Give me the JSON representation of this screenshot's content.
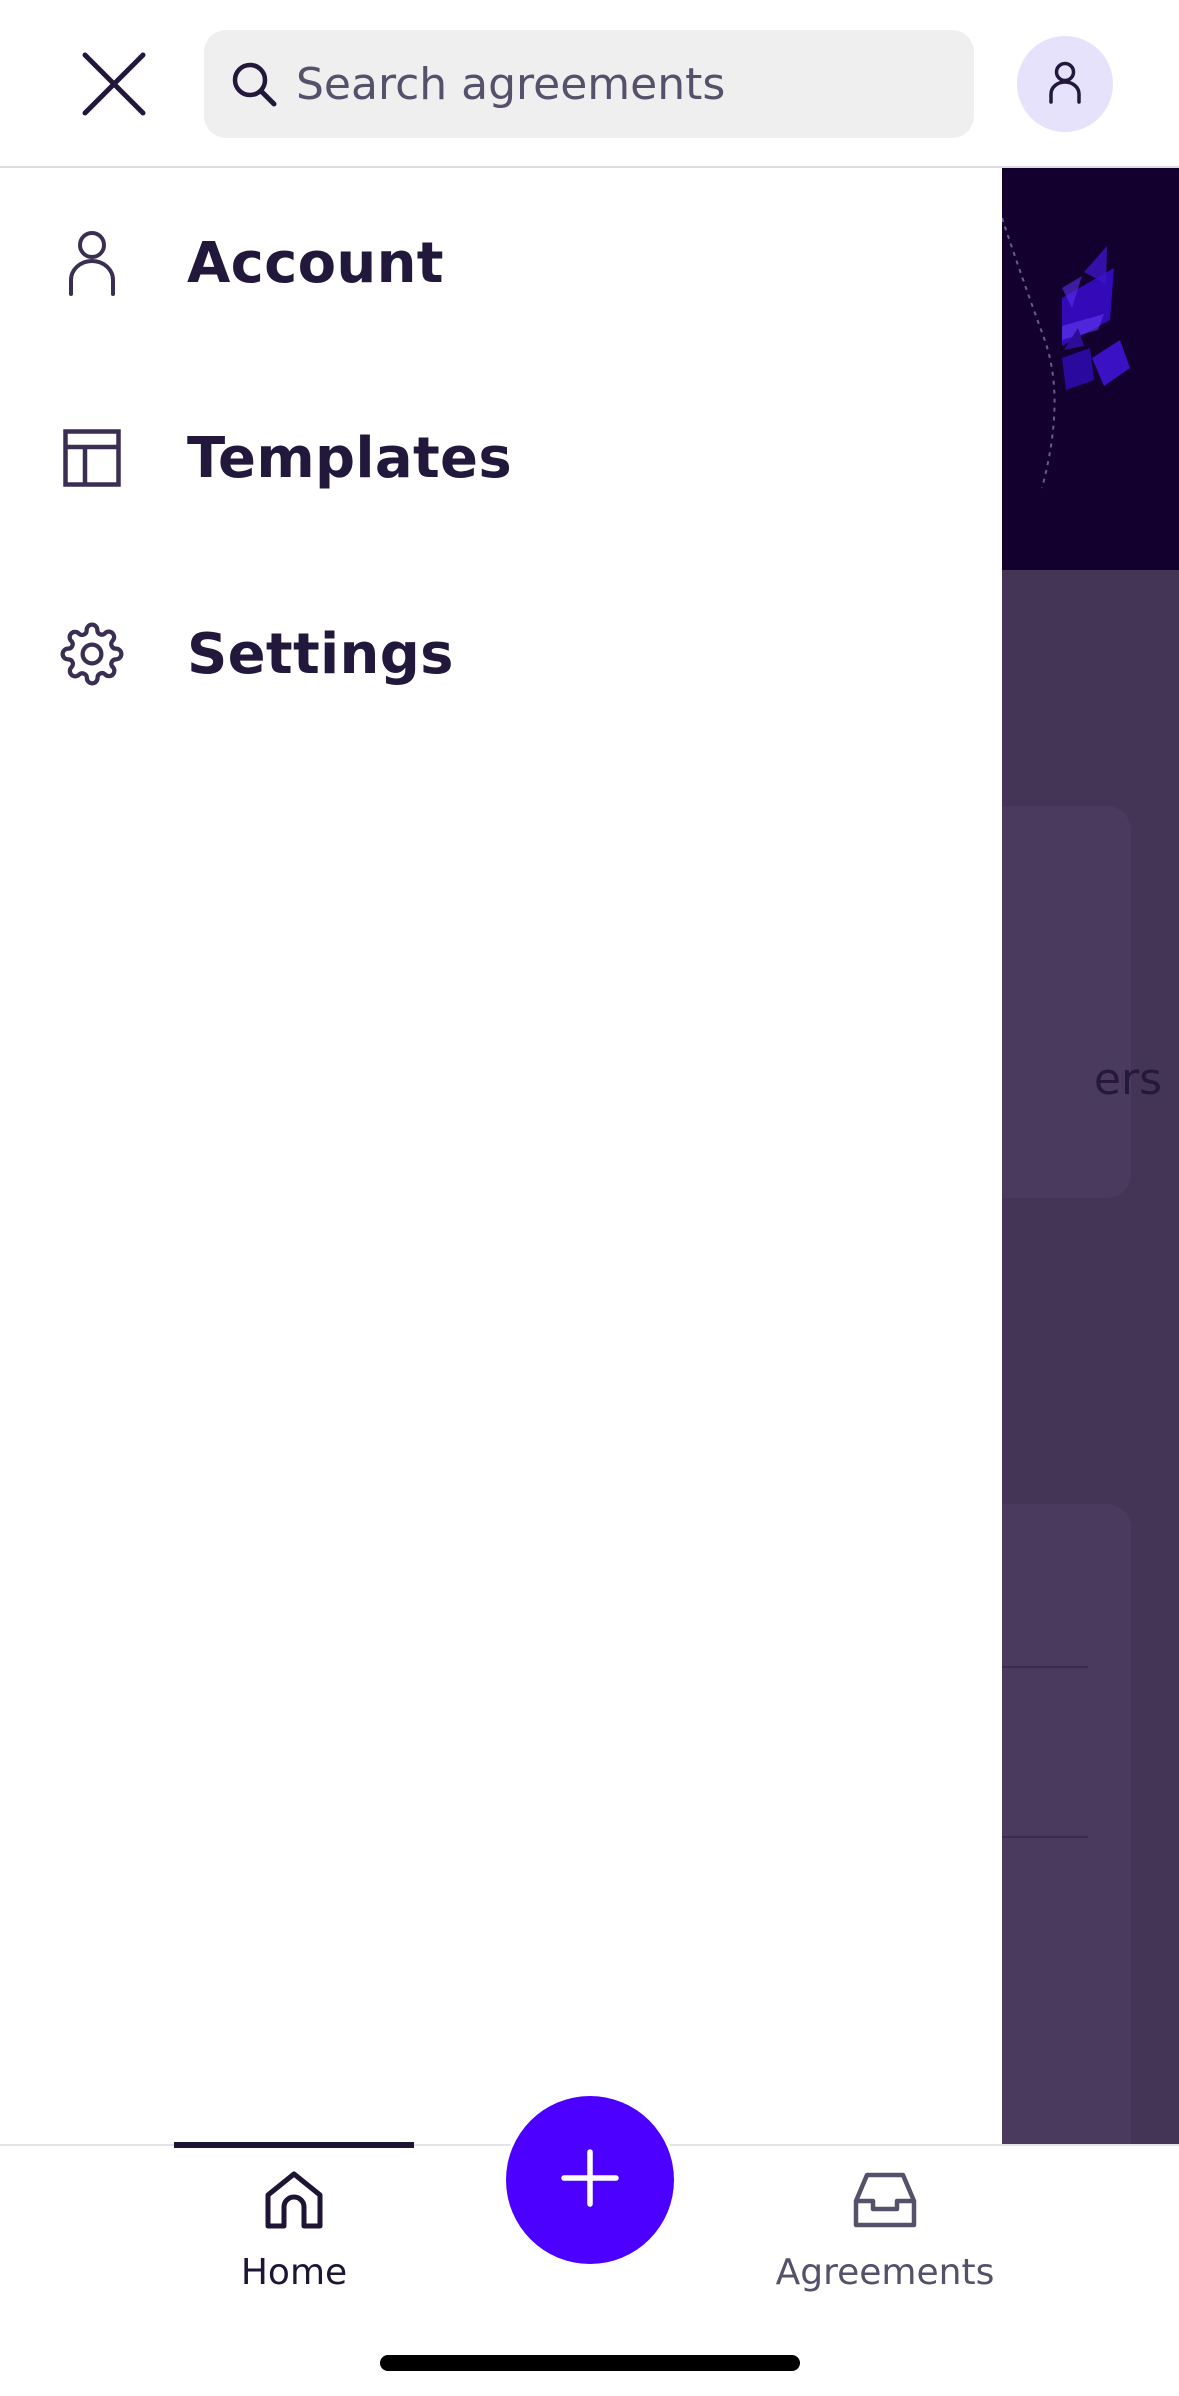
{
  "header": {
    "close_icon": "close-icon",
    "search": {
      "placeholder": "Search agreements",
      "value": "",
      "icon": "search-icon"
    },
    "avatar_icon": "person-icon"
  },
  "drawer": {
    "items": [
      {
        "label": "Account",
        "icon": "person-icon"
      },
      {
        "label": "Templates",
        "icon": "template-layout-icon"
      },
      {
        "label": "Settings",
        "icon": "gear-icon"
      }
    ]
  },
  "background": {
    "card_text_fragment": "ers"
  },
  "bottom_nav": {
    "tabs": [
      {
        "label": "Home",
        "icon": "home-icon",
        "active": true
      },
      {
        "label": "Agreements",
        "icon": "inbox-icon",
        "active": false
      }
    ],
    "fab_icon": "plus-icon"
  },
  "colors": {
    "accent": "#4c00ff",
    "text_primary": "#22183c",
    "avatar_bg": "#e6e2fb",
    "search_bg": "#efeff0",
    "overlay": "#443456",
    "hero_dark": "#13002e"
  }
}
